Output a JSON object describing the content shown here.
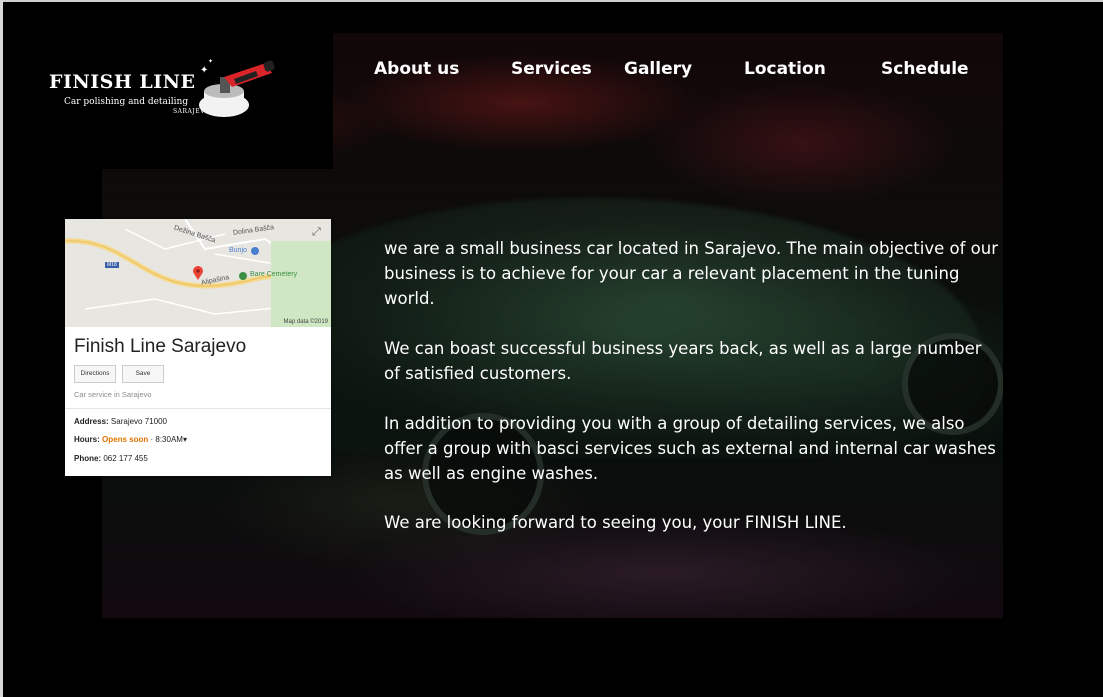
{
  "logo": {
    "title": "FINISH LINE",
    "subtitle": "Car polishing and detailing",
    "city": "SARAJEVO"
  },
  "nav": {
    "items": [
      "About us",
      "Services",
      "Gallery",
      "Location",
      "Schedule"
    ]
  },
  "map_card": {
    "map_labels": {
      "area1": "Dežina Bašča",
      "area2": "Dolina Bašča",
      "poi_blue": "Bunjo",
      "poi_green": "Bare Cemetery",
      "street": "Alipašina",
      "road": "M18"
    },
    "map_credit": "Map data ©2019",
    "place_name": "Finish Line Sarajevo",
    "directions_label": "Directions",
    "save_label": "Save",
    "category": "Car service in Sarajevo",
    "address_label": "Address:",
    "address_value": "Sarajevo 71000",
    "hours_label": "Hours:",
    "hours_status": "Opens soon",
    "hours_time": "· 8:30AM▾",
    "phone_label": "Phone:",
    "phone_value": "062 177 455"
  },
  "content": {
    "paragraphs": [
      "we are a small business car located in Sarajevo. The main objective of our business is to achieve for your car a relevant placement in the tuning world.",
      "We can boast successful business years back, as well as a large number of satisfied customers.",
      "In addition to providing you with a group of detailing services, we also offer a group with basci services such as external and internal car washes as well as engine washes.",
      "We are looking forward to seeing you, your FINISH LINE."
    ]
  },
  "colors": {
    "page_bg": "#000000",
    "text": "#ffffff",
    "hours_status": "#e37400",
    "logo_accent": "#d9252a"
  }
}
